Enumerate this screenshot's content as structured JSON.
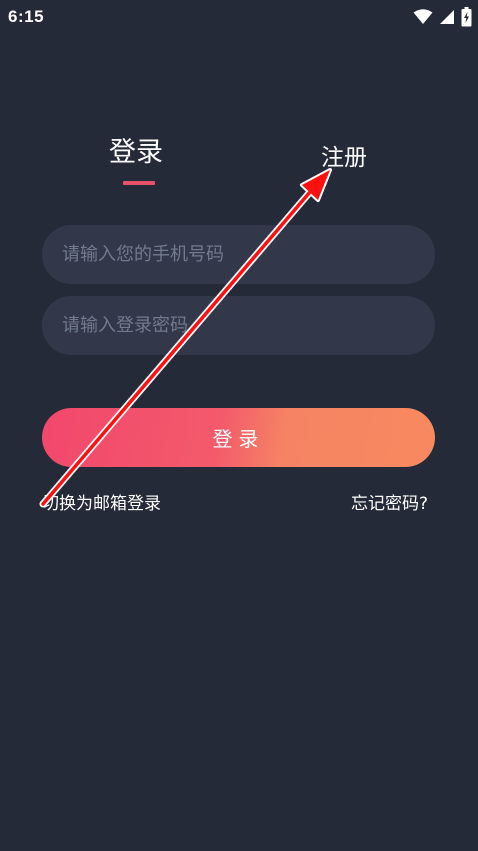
{
  "status_bar": {
    "time": "6:15",
    "icons": [
      "wifi-icon",
      "signal-icon",
      "battery-icon"
    ]
  },
  "tabs": {
    "login_label": "登录",
    "register_label": "注册",
    "active": "login"
  },
  "form": {
    "phone_placeholder": "请输入您的手机号码",
    "password_placeholder": "请输入登录密码",
    "login_button_label": "登录"
  },
  "links": {
    "switch_email_label": "切换为邮箱登录",
    "forgot_password_label": "忘记密码?"
  },
  "colors": {
    "background": "#252a38",
    "input_background": "#323849",
    "accent": "#e9506a",
    "button_gradient_start": "#f2476c",
    "button_gradient_end": "#f7895f",
    "annotation_arrow": "#ff1010"
  }
}
